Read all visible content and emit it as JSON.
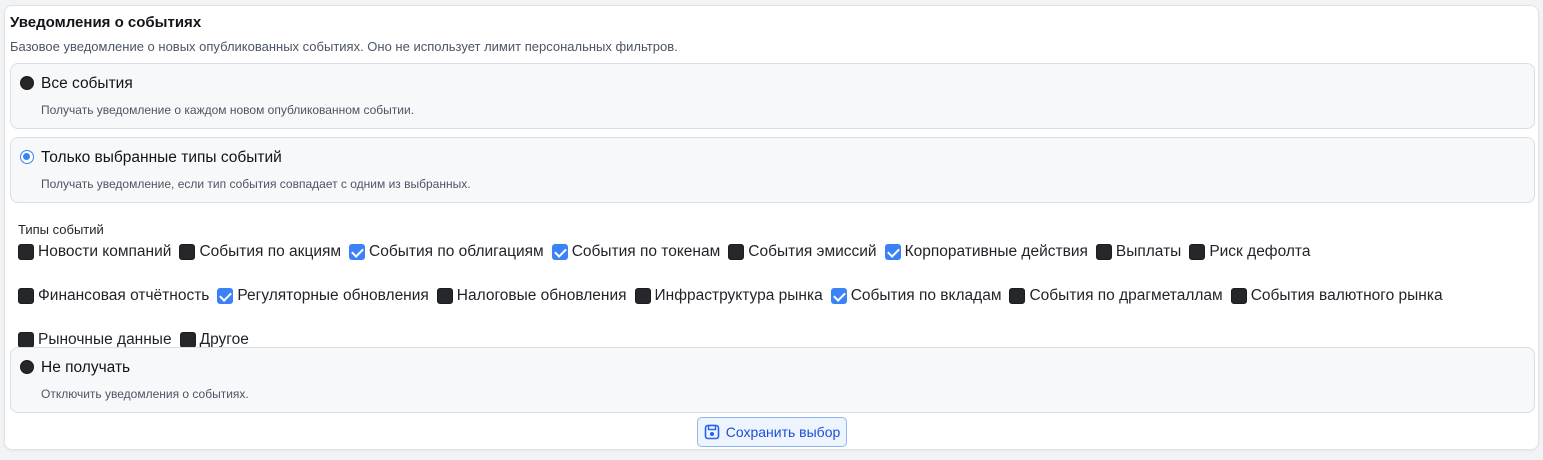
{
  "card": {
    "title": "Уведомления о событиях",
    "description": "Базовое уведомление о новых опубликованных событиях. Оно не использует лимит персональных фильтров."
  },
  "options": {
    "all": {
      "label": "Все события",
      "hint": "Получать уведомление о каждом новом опубликованном событии.",
      "selected": false
    },
    "selected_types": {
      "label": "Только выбранные типы событий",
      "hint": "Получать уведомление, если тип события совпадает с одним из выбранных.",
      "selected": true
    },
    "none": {
      "label": "Не получать",
      "hint": "Отключить уведомления о событиях.",
      "selected": false
    }
  },
  "event_types": {
    "title": "Типы событий",
    "items": [
      {
        "label": "Новости компаний",
        "checked": false
      },
      {
        "label": "События по акциям",
        "checked": false
      },
      {
        "label": "События по облигациям",
        "checked": true
      },
      {
        "label": "События по токенам",
        "checked": true
      },
      {
        "label": "События эмиссий",
        "checked": false
      },
      {
        "label": "Корпоративные действия",
        "checked": true
      },
      {
        "label": "Выплаты",
        "checked": false
      },
      {
        "label": "Риск дефолта",
        "checked": false
      },
      {
        "label": "Финансовая отчётность",
        "checked": false
      },
      {
        "label": "Регуляторные обновления",
        "checked": true
      },
      {
        "label": "Налоговые обновления",
        "checked": false
      },
      {
        "label": "Инфраструктура рынка",
        "checked": false
      },
      {
        "label": "События по вкладам",
        "checked": true
      },
      {
        "label": "События по драгметаллам",
        "checked": false
      },
      {
        "label": "События валютного рынка",
        "checked": false
      },
      {
        "label": "Рыночные данные",
        "checked": false
      },
      {
        "label": "Другое",
        "checked": false
      }
    ]
  },
  "save_button": {
    "label": "Сохранить выбор",
    "icon": "save-icon"
  },
  "colors": {
    "accent": "#3b82f6",
    "checkbox_off": "#25272b"
  }
}
